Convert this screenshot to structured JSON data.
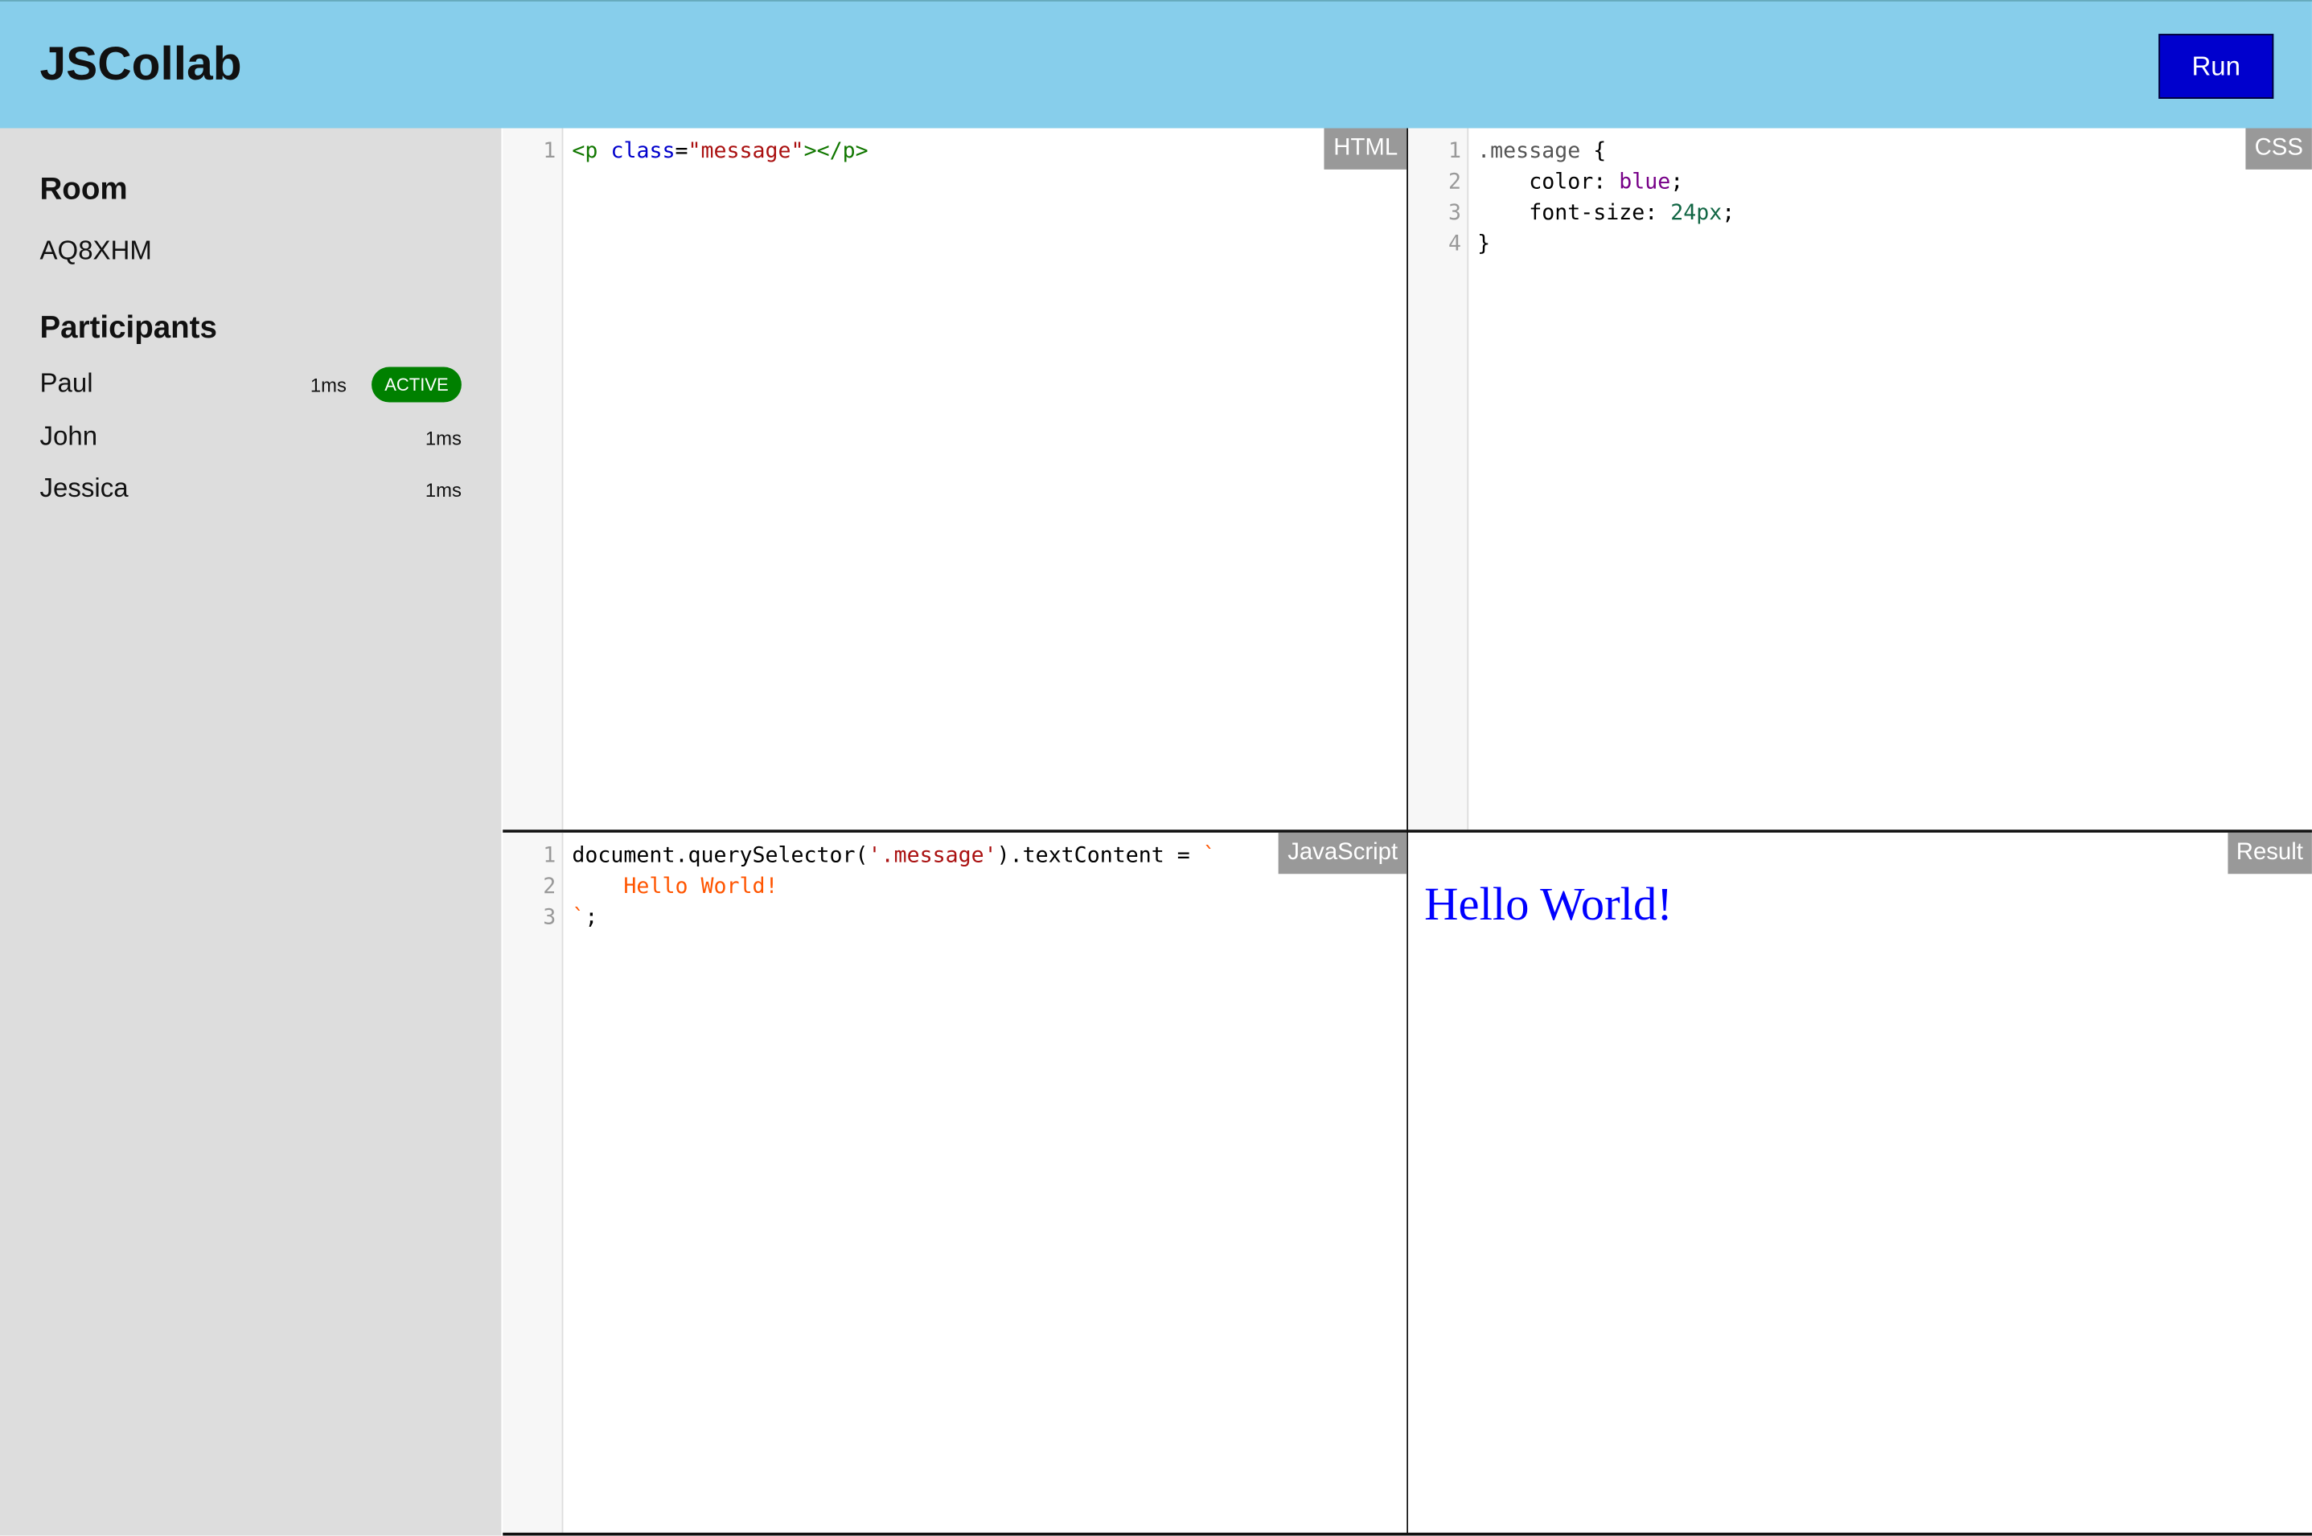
{
  "header": {
    "title": "JSCollab",
    "run_label": "Run"
  },
  "sidebar": {
    "room_heading": "Room",
    "room_code": "AQ8XHM",
    "participants_heading": "Participants",
    "participants": [
      {
        "name": "Paul",
        "latency": "1ms",
        "badge": "ACTIVE"
      },
      {
        "name": "John",
        "latency": "1ms"
      },
      {
        "name": "Jessica",
        "latency": "1ms"
      }
    ]
  },
  "colors": {
    "header": "#87ceeb",
    "run": "#0000cd",
    "active": "#008000",
    "sidebar": "#dddddd"
  },
  "editors": {
    "html": {
      "label": "HTML",
      "lines": [
        [
          [
            "tag",
            "<p "
          ],
          [
            "attr",
            "class"
          ],
          [
            "plain",
            "="
          ],
          [
            "str",
            "\"message\""
          ],
          [
            "tag",
            "></p>"
          ]
        ]
      ]
    },
    "css": {
      "label": "CSS",
      "lines": [
        [
          [
            "qual",
            ".message"
          ],
          [
            "plain",
            " {"
          ]
        ],
        [
          [
            "plain",
            "    color: "
          ],
          [
            "kw",
            "blue"
          ],
          [
            "plain",
            ";"
          ]
        ],
        [
          [
            "plain",
            "    font-size: "
          ],
          [
            "num",
            "24px"
          ],
          [
            "plain",
            ";"
          ]
        ],
        [
          [
            "plain",
            "}"
          ]
        ]
      ]
    },
    "js": {
      "label": "JavaScript",
      "lines": [
        [
          [
            "plain",
            "document.querySelector("
          ],
          [
            "str",
            "'.message'"
          ],
          [
            "plain",
            ").textContent = "
          ],
          [
            "str2",
            "`"
          ]
        ],
        [
          [
            "str2",
            "    Hello World!"
          ]
        ],
        [
          [
            "str2",
            "`"
          ],
          [
            "plain",
            ";"
          ]
        ]
      ]
    }
  },
  "result": {
    "label": "Result",
    "text": "Hello World!"
  }
}
